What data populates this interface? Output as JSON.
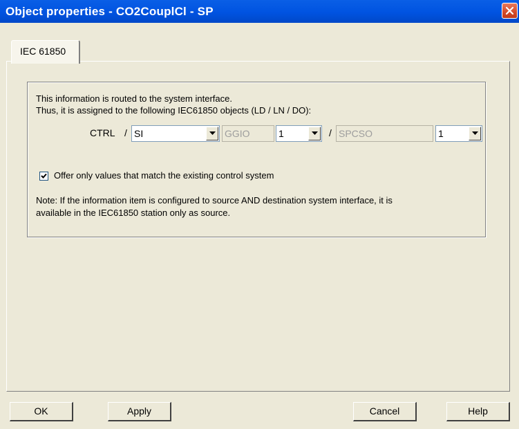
{
  "window": {
    "title": "Object properties - CO2CouplCl - SP"
  },
  "tabs": [
    {
      "label": "IEC 61850"
    }
  ],
  "group": {
    "info_line1": "This information is routed to the system interface.",
    "info_line2": "Thus, it is assigned to the following IEC61850 objects (LD / LN / DO):",
    "ld_prefix": "CTRL",
    "sep1": "/",
    "sep2": "/",
    "ld_combo": "SI",
    "ln_combo": "GGIO",
    "ln_instance": "1",
    "do_combo": "SPCSO",
    "do_instance": "1",
    "checkbox_label": "Offer only values that match the existing control system",
    "checkbox_checked": true,
    "note_line1": "Note: If the information item is configured to source AND destination system interface, it is",
    "note_line2": "available in the IEC61850 station only as source."
  },
  "buttons": {
    "ok": "OK",
    "apply": "Apply",
    "cancel": "Cancel",
    "help": "Help"
  }
}
